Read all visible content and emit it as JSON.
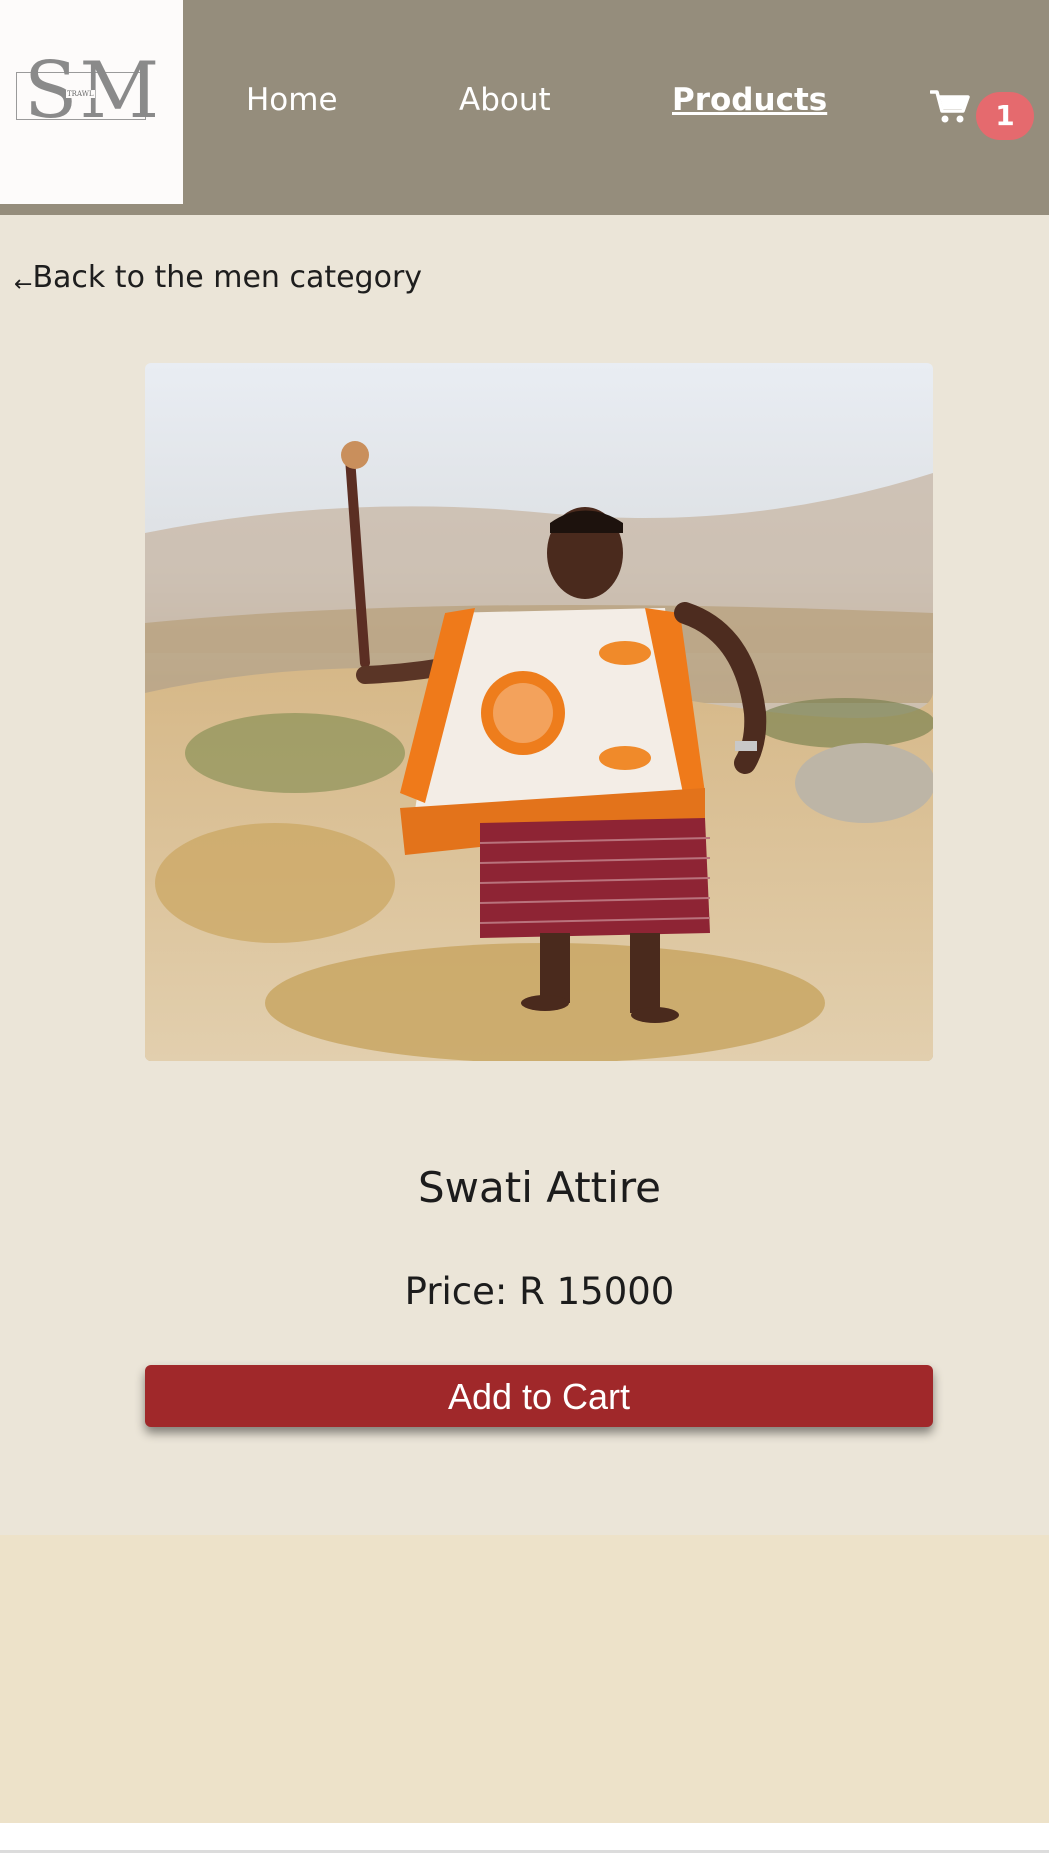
{
  "logo": {
    "letters": "SM",
    "small_text": "TRAWL"
  },
  "nav": {
    "home": "Home",
    "about": "About",
    "products": "Products"
  },
  "cart": {
    "icon": "shopping-cart-icon",
    "count": "1"
  },
  "back_link": {
    "arrow": "←",
    "label": "Back to the men category"
  },
  "product": {
    "image_alt": "Swati Attire",
    "title": "Swati Attire",
    "price": "Price: R 15000",
    "add_to_cart": "Add to Cart"
  },
  "colors": {
    "header": "#958d7c",
    "page_bg": "#ebe5d8",
    "button": "#a0282a",
    "badge": "#e56a6e",
    "footer": "#ede2c9"
  }
}
